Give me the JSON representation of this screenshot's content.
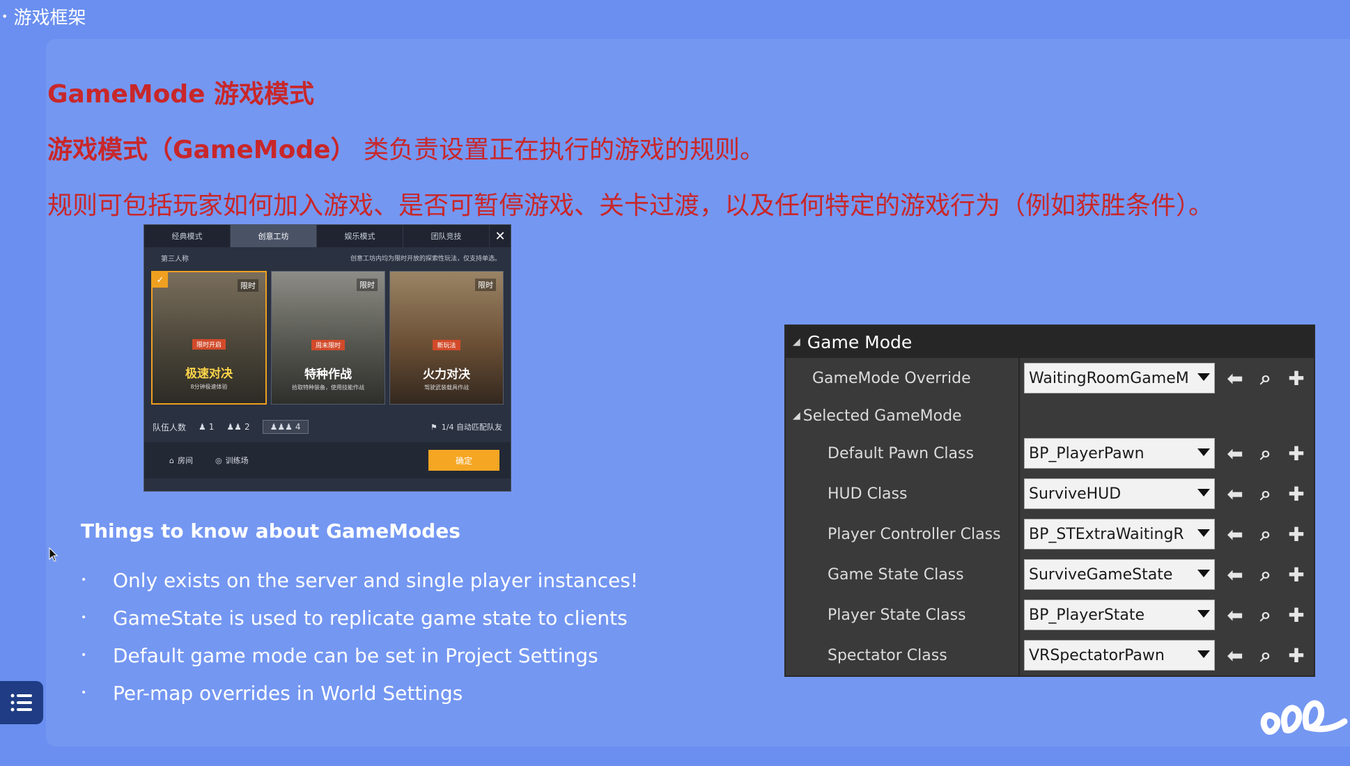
{
  "section": {
    "bullet": "•",
    "title": "游戏框架"
  },
  "slide": {
    "heading": "GameMode 游戏模式",
    "para1_bold": "游戏模式（GameMode）",
    "para1_rest": " 类负责设置正在执行的游戏的规则。",
    "para2": "规则可包括玩家如何加入游戏、是否可暂停游戏、关卡过渡，以及任何特定的游戏行为（例如获胜条件）。"
  },
  "game_shot": {
    "tabs": [
      "经典模式",
      "创意工坊",
      "娱乐模式",
      "团队竞技"
    ],
    "close": "✕",
    "perspective": "第三人称",
    "hint": "创意工坊内均为限时开放的探索性玩法，仅支持单选。",
    "cards": [
      {
        "badge": "限时",
        "tag": "限时开启",
        "name": "极速对决",
        "desc": "8分钟极速体验"
      },
      {
        "badge": "限时",
        "tag": "周末限时",
        "name": "特种作战",
        "desc": "拾取特种装备，使用技能作战"
      },
      {
        "badge": "限时",
        "tag": "新玩法",
        "name": "火力对决",
        "desc": "驾驶武装载具作战"
      }
    ],
    "team_label": "队伍人数",
    "team_options": [
      "1",
      "2",
      "4"
    ],
    "auto_match": "1/4  自动匹配队友",
    "room": "房间",
    "training": "训练场",
    "confirm": "确定"
  },
  "things": {
    "title": "Things to know about GameModes",
    "bullet": "•",
    "items": [
      "Only exists on the server and single player instances!",
      "GameState is used to replicate game state to clients",
      "Default game mode can be set in Project Settings",
      "Per-map overrides in World Settings"
    ]
  },
  "ue_panel": {
    "title": "Game Mode",
    "override_label": "GameMode Override",
    "override_value": "WaitingRoomGameM",
    "group_label": "Selected GameMode",
    "rows": [
      {
        "label": "Default Pawn Class",
        "value": "BP_PlayerPawn"
      },
      {
        "label": "HUD Class",
        "value": "SurviveHUD"
      },
      {
        "label": "Player Controller Class",
        "value": "BP_STExtraWaitingR"
      },
      {
        "label": "Game State Class",
        "value": "SurviveGameState"
      },
      {
        "label": "Player State Class",
        "value": "BP_PlayerState"
      },
      {
        "label": "Spectator Class",
        "value": "VRSpectatorPawn"
      }
    ],
    "icons": {
      "back": "arrow-left-icon",
      "browse": "search-icon",
      "add": "plus-icon"
    }
  },
  "colors": {
    "background": "#6a8ff0",
    "slide": "#7497f2",
    "accent_red": "#c8272a",
    "menu_button": "#1f3c84"
  }
}
